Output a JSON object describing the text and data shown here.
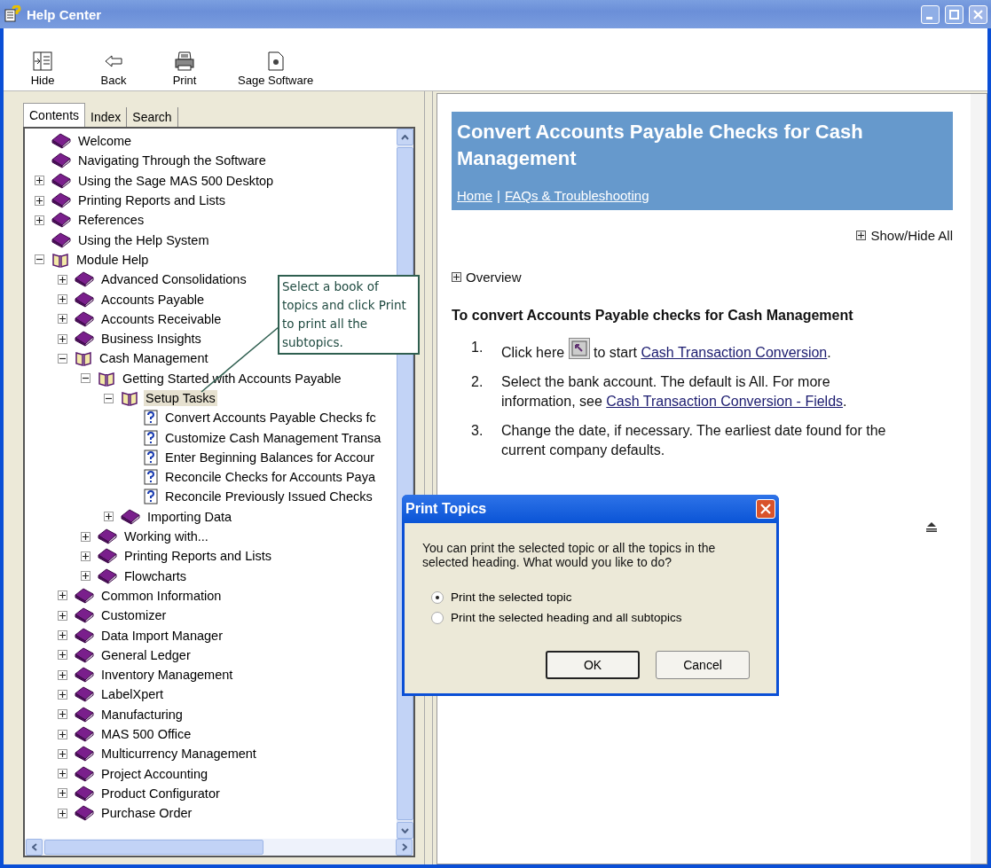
{
  "window": {
    "title": "Help Center"
  },
  "toolbar": [
    {
      "label": "Hide",
      "kind": "hide"
    },
    {
      "label": "Back",
      "kind": "back"
    },
    {
      "label": "Print",
      "kind": "print"
    },
    {
      "label": "Sage Software",
      "kind": "page"
    }
  ],
  "tabs": [
    {
      "label": "Contents",
      "selected": true
    },
    {
      "label": "Index",
      "selected": false
    },
    {
      "label": "Search",
      "selected": false
    }
  ],
  "tree": [
    {
      "label": "Welcome",
      "kind": "book",
      "selected": false
    },
    {
      "label": "Navigating Through the Software",
      "kind": "book",
      "selected": false
    },
    {
      "label": "Using the Sage MAS 500 Desktop",
      "kind": "book",
      "expanded": false,
      "selected": false
    },
    {
      "label": "Printing Reports and Lists",
      "kind": "book",
      "expanded": false,
      "selected": false
    },
    {
      "label": "References",
      "kind": "book",
      "expanded": false,
      "selected": false
    },
    {
      "label": "Using the Help System",
      "kind": "book",
      "selected": false
    },
    {
      "label": "Module Help",
      "kind": "open-book",
      "expanded": true,
      "selected": false,
      "children": [
        {
          "label": "Advanced Consolidations",
          "kind": "book",
          "expanded": false,
          "selected": false
        },
        {
          "label": "Accounts Payable",
          "kind": "book",
          "expanded": false,
          "selected": false
        },
        {
          "label": "Accounts Receivable",
          "kind": "book",
          "expanded": false,
          "selected": false
        },
        {
          "label": "Business Insights",
          "kind": "book",
          "expanded": false,
          "selected": false
        },
        {
          "label": "Cash Management",
          "kind": "open-book",
          "expanded": true,
          "selected": false,
          "children": [
            {
              "label": "Getting Started with Accounts Payable",
              "kind": "open-book",
              "expanded": true,
              "selected": false,
              "children": [
                {
                  "label": "Setup Tasks",
                  "kind": "open-book",
                  "expanded": true,
                  "selected": true,
                  "children": [
                    {
                      "label": "Convert Accounts Payable Checks fc",
                      "kind": "topic",
                      "selected": false
                    },
                    {
                      "label": "Customize Cash Management Transa",
                      "kind": "topic",
                      "selected": false
                    },
                    {
                      "label": "Enter Beginning Balances for Accour",
                      "kind": "topic",
                      "selected": false
                    },
                    {
                      "label": "Reconcile Checks for Accounts Paya",
                      "kind": "topic",
                      "selected": false
                    },
                    {
                      "label": "Reconcile Previously Issued Checks",
                      "kind": "topic",
                      "selected": false
                    }
                  ]
                },
                {
                  "label": "Importing Data",
                  "kind": "book",
                  "expanded": false,
                  "selected": false
                }
              ]
            },
            {
              "label": "Working with...",
              "kind": "book",
              "expanded": false,
              "selected": false
            },
            {
              "label": "Printing Reports and Lists",
              "kind": "book",
              "expanded": false,
              "selected": false
            },
            {
              "label": "Flowcharts",
              "kind": "book",
              "expanded": false,
              "selected": false
            }
          ]
        },
        {
          "label": "Common Information",
          "kind": "book",
          "expanded": false,
          "selected": false
        },
        {
          "label": "Customizer",
          "kind": "book",
          "expanded": false,
          "selected": false
        },
        {
          "label": "Data Import Manager",
          "kind": "book",
          "expanded": false,
          "selected": false
        },
        {
          "label": "General Ledger",
          "kind": "book",
          "expanded": false,
          "selected": false
        },
        {
          "label": "Inventory Management",
          "kind": "book",
          "expanded": false,
          "selected": false
        },
        {
          "label": "LabelXpert",
          "kind": "book",
          "expanded": false,
          "selected": false
        },
        {
          "label": "Manufacturing",
          "kind": "book",
          "expanded": false,
          "selected": false
        },
        {
          "label": "MAS 500 Office",
          "kind": "book",
          "expanded": false,
          "selected": false
        },
        {
          "label": "Multicurrency Management",
          "kind": "book",
          "expanded": false,
          "selected": false
        },
        {
          "label": "Project Accounting",
          "kind": "book",
          "expanded": false,
          "selected": false
        },
        {
          "label": "Product Configurator",
          "kind": "book",
          "expanded": false,
          "selected": false
        },
        {
          "label": "Purchase Order",
          "kind": "book",
          "expanded": false,
          "selected": false
        }
      ]
    }
  ],
  "callout": "Select a book of topics and click Print to print all the subtopics.",
  "article": {
    "title": "Convert Accounts Payable Checks for Cash Management",
    "links": [
      "Home",
      "FAQs & Troubleshooting"
    ],
    "separator": "|",
    "show_hide": "Show/Hide All",
    "overview": "Overview",
    "heading": "To convert Accounts Payable checks for Cash Management",
    "steps": [
      {
        "number": "1.",
        "parts": [
          {
            "text": "Click here "
          },
          {
            "kind": "button"
          },
          {
            "text": " to start "
          },
          {
            "link": "Cash Transaction Conversion"
          },
          {
            "text": "."
          }
        ]
      },
      {
        "number": "2.",
        "parts": [
          {
            "text": "Select the bank account. The default is All. For more information, see "
          },
          {
            "link": "Cash Transaction Conversion - Fields"
          },
          {
            "text": "."
          }
        ]
      },
      {
        "number": "3.",
        "parts": [
          {
            "text": "Change the date, if necessary. The earliest date found for the current company defaults."
          }
        ]
      }
    ]
  },
  "dialog": {
    "title": "Print Topics",
    "message": "You can print the selected topic or all the topics in the selected heading. What would you like to do?",
    "options": [
      {
        "label": "Print the selected topic",
        "selected": true
      },
      {
        "label": "Print the selected heading and all subtopics",
        "selected": false
      }
    ],
    "buttons": [
      {
        "label": "OK",
        "default": true
      },
      {
        "label": "Cancel",
        "default": false
      }
    ]
  }
}
